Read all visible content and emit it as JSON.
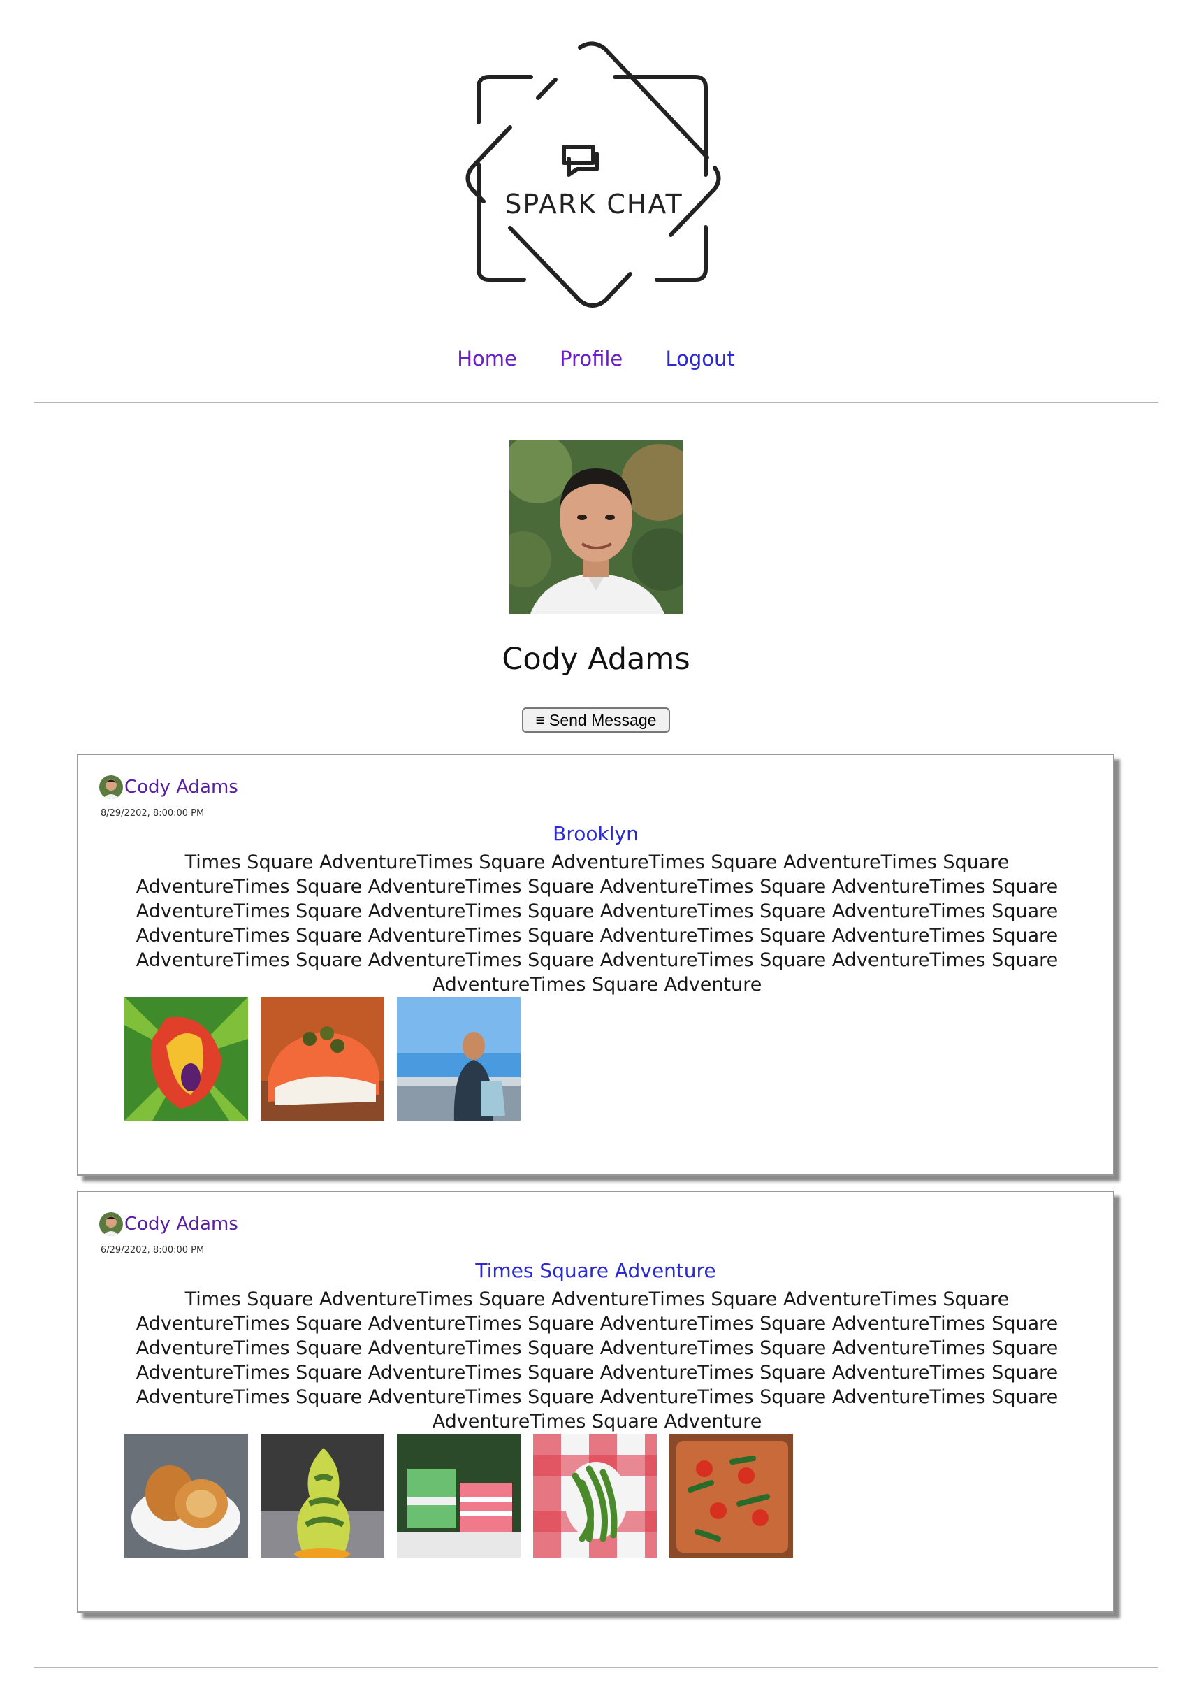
{
  "brand": {
    "logo_text": "SPARK CHAT"
  },
  "nav": {
    "home": "Home",
    "profile": "Profile",
    "logout": "Logout"
  },
  "profile": {
    "name": "Cody Adams",
    "send_message_label": "Send Message",
    "send_message_icon": "hamburger-icon"
  },
  "posts": [
    {
      "author": "Cody Adams",
      "date": "8/29/2202, 8:00:00 PM",
      "title": "Brooklyn",
      "body": "Times Square AdventureTimes Square AdventureTimes Square AdventureTimes Square AdventureTimes Square AdventureTimes Square AdventureTimes Square AdventureTimes Square AdventureTimes Square AdventureTimes Square AdventureTimes Square AdventureTimes Square AdventureTimes Square AdventureTimes Square AdventureTimes Square AdventureTimes Square AdventureTimes Square AdventureTimes Square AdventureTimes Square AdventureTimes Square AdventureTimes Square Adventure",
      "images": [
        "tulip-photo",
        "salmon-bagel-photo",
        "woman-marina-photo"
      ]
    },
    {
      "author": "Cody Adams",
      "date": "6/29/2202, 8:00:00 PM",
      "title": "Times Square Adventure",
      "body": "Times Square AdventureTimes Square AdventureTimes Square AdventureTimes Square AdventureTimes Square AdventureTimes Square AdventureTimes Square AdventureTimes Square AdventureTimes Square AdventureTimes Square AdventureTimes Square AdventureTimes Square AdventureTimes Square AdventureTimes Square AdventureTimes Square AdventureTimes Square AdventureTimes Square AdventureTimes Square AdventureTimes Square AdventureTimes Square AdventureTimes Square Adventure",
      "images": [
        "mooncake-photo",
        "soft-serve-photo",
        "layer-cake-photo",
        "green-beans-photo",
        "pizza-photo"
      ]
    }
  ],
  "colors": {
    "nav_visited": "#6a1fc4",
    "link": "#2a2ad0",
    "author": "#5a1fa0"
  }
}
